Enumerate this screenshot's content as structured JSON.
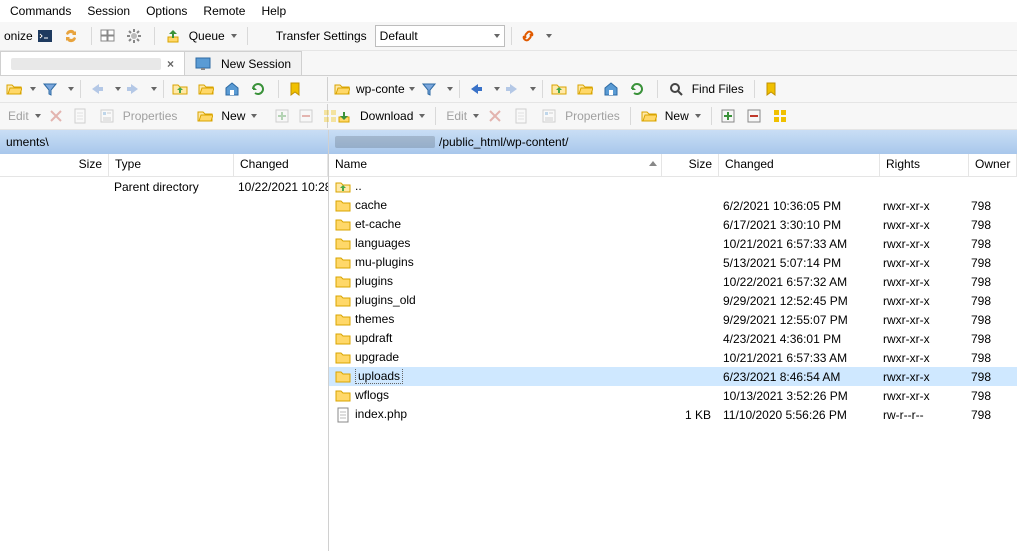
{
  "menu": {
    "items": [
      "Commands",
      "Session",
      "Options",
      "Remote",
      "Help"
    ]
  },
  "toolbar1": {
    "onize": "onize",
    "queue_label": "Queue",
    "transfer_label": "Transfer Settings",
    "transfer_value": "Default"
  },
  "tabs": {
    "active_blurred": true,
    "close": "×",
    "new_session": "New Session"
  },
  "nav": {
    "remote_label": "wp-conte",
    "find_files": "Find Files"
  },
  "editbar": {
    "edit": "Edit",
    "properties": "Properties",
    "new": "New",
    "download": "Download"
  },
  "local": {
    "path_suffix": "uments\\",
    "columns": {
      "size": "Size",
      "type": "Type",
      "changed": "Changed"
    },
    "rows": [
      {
        "name": "",
        "type": "Parent directory",
        "changed": "10/22/2021 10:28"
      }
    ]
  },
  "remote": {
    "path_suffix": "/public_html/wp-content/",
    "columns": {
      "name": "Name",
      "size": "Size",
      "changed": "Changed",
      "rights": "Rights",
      "owner": "Owner"
    },
    "rows": [
      {
        "icon": "up",
        "name": "..",
        "size": "",
        "changed": "",
        "rights": "",
        "owner": ""
      },
      {
        "icon": "folder",
        "name": "cache",
        "size": "",
        "changed": "6/2/2021 10:36:05 PM",
        "rights": "rwxr-xr-x",
        "owner": "798"
      },
      {
        "icon": "folder",
        "name": "et-cache",
        "size": "",
        "changed": "6/17/2021 3:30:10 PM",
        "rights": "rwxr-xr-x",
        "owner": "798"
      },
      {
        "icon": "folder",
        "name": "languages",
        "size": "",
        "changed": "10/21/2021 6:57:33 AM",
        "rights": "rwxr-xr-x",
        "owner": "798"
      },
      {
        "icon": "folder",
        "name": "mu-plugins",
        "size": "",
        "changed": "5/13/2021 5:07:14 PM",
        "rights": "rwxr-xr-x",
        "owner": "798"
      },
      {
        "icon": "folder",
        "name": "plugins",
        "size": "",
        "changed": "10/22/2021 6:57:32 AM",
        "rights": "rwxr-xr-x",
        "owner": "798"
      },
      {
        "icon": "folder",
        "name": "plugins_old",
        "size": "",
        "changed": "9/29/2021 12:52:45 PM",
        "rights": "rwxr-xr-x",
        "owner": "798"
      },
      {
        "icon": "folder",
        "name": "themes",
        "size": "",
        "changed": "9/29/2021 12:55:07 PM",
        "rights": "rwxr-xr-x",
        "owner": "798"
      },
      {
        "icon": "folder",
        "name": "updraft",
        "size": "",
        "changed": "4/23/2021 4:36:01 PM",
        "rights": "rwxr-xr-x",
        "owner": "798"
      },
      {
        "icon": "folder",
        "name": "upgrade",
        "size": "",
        "changed": "10/21/2021 6:57:33 AM",
        "rights": "rwxr-xr-x",
        "owner": "798"
      },
      {
        "icon": "folder",
        "name": "uploads",
        "size": "",
        "changed": "6/23/2021 8:46:54 AM",
        "rights": "rwxr-xr-x",
        "owner": "798",
        "selected": true
      },
      {
        "icon": "folder",
        "name": "wflogs",
        "size": "",
        "changed": "10/13/2021 3:52:26 PM",
        "rights": "rwxr-xr-x",
        "owner": "798"
      },
      {
        "icon": "file",
        "name": "index.php",
        "size": "1 KB",
        "changed": "11/10/2020 5:56:26 PM",
        "rights": "rw-r--r--",
        "owner": "798"
      }
    ]
  }
}
